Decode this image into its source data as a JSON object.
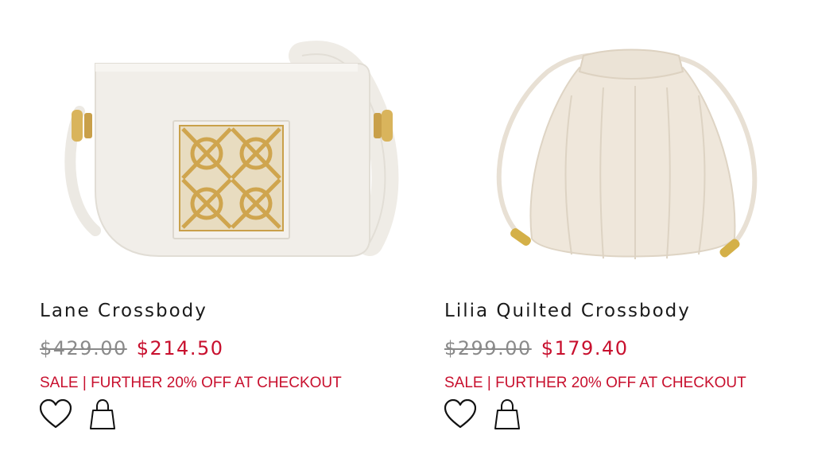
{
  "products": [
    {
      "name": "Lane Crossbody",
      "original_price": "$429.00",
      "sale_price": "$214.50",
      "promo": "SALE | FURTHER 20% OFF AT CHECKOUT",
      "image_icon": "white-flap-crossbody-bag-image"
    },
    {
      "name": "Lilia Quilted Crossbody",
      "original_price": "$299.00",
      "sale_price": "$179.40",
      "promo": "SALE | FURTHER 20% OFF AT CHECKOUT",
      "image_icon": "cream-drawstring-quilted-bag-image"
    }
  ],
  "icons": {
    "wishlist": "heart-icon",
    "add_to_bag": "shopping-bag-icon"
  },
  "colors": {
    "sale_red": "#c8102e",
    "strikethrough_grey": "#8a8a8a",
    "title_text": "#1a1a1a"
  }
}
